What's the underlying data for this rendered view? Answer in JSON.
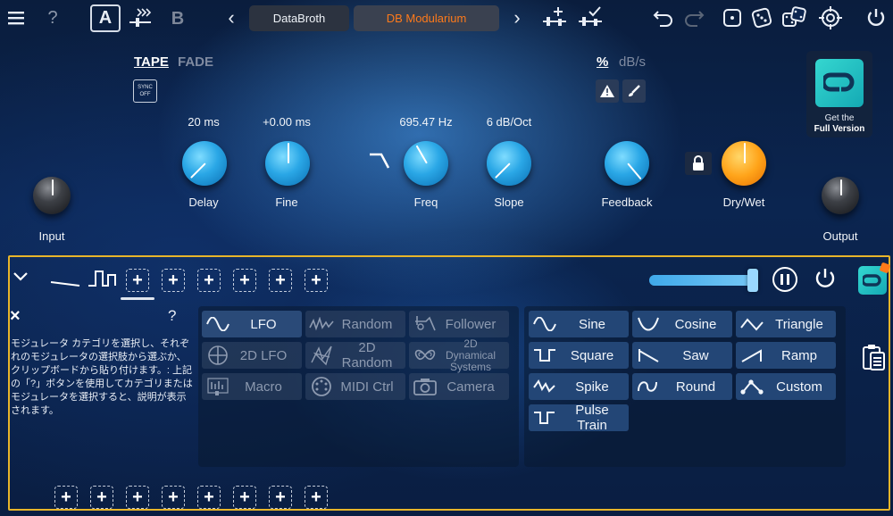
{
  "topbar": {
    "help_label": "?",
    "a_label": "A",
    "b_label": "B",
    "prev_glyph": "‹",
    "next_glyph": "›",
    "preset_left": "DataBroth",
    "preset_right": "DB Modularium"
  },
  "mode": {
    "tape": "TAPE",
    "fade": "FADE",
    "sync_top": "SYNC",
    "sync_bottom": "OFF"
  },
  "units": {
    "percent": "%",
    "db": "dB/s"
  },
  "promo": {
    "line1": "Get the",
    "line2": "Full Version"
  },
  "knobs": {
    "delay": {
      "label": "Delay",
      "value": "20 ms"
    },
    "fine": {
      "label": "Fine",
      "value": "+0.00 ms"
    },
    "freq": {
      "label": "Freq",
      "value": "695.47 Hz"
    },
    "slope": {
      "label": "Slope",
      "value": "6 dB/Oct"
    },
    "feedback": {
      "label": "Feedback"
    },
    "drywet": {
      "label": "Dry/Wet"
    },
    "input": {
      "label": "Input"
    },
    "output": {
      "label": "Output"
    }
  },
  "mod": {
    "close_glyph": "×",
    "help_glyph": "?",
    "add_glyph": "+",
    "description": "モジュレータ カテゴリを選択し、それぞれのモジュレータの選択肢から選ぶか、クリップボードから貼り付けます。: 上記の「?」ボタンを使用してカテゴリまたはモジュレータを選択すると、説明が表示されます。",
    "categories": [
      {
        "label": "LFO",
        "icon": "sine-icon",
        "active": true
      },
      {
        "label": "Random",
        "icon": "random-icon",
        "active": false
      },
      {
        "label": "Follower",
        "icon": "follower-icon",
        "active": false
      },
      {
        "label": "2D LFO",
        "icon": "crosshair-icon",
        "active": false
      },
      {
        "label": "2D Random",
        "icon": "2d-random-icon",
        "active": false
      },
      {
        "label": "2D Dynamical Systems",
        "icon": "attractor-icon",
        "active": false
      },
      {
        "label": "Macro",
        "icon": "macro-icon",
        "active": false
      },
      {
        "label": "MIDI Ctrl",
        "icon": "midi-icon",
        "active": false
      },
      {
        "label": "Camera",
        "icon": "camera-icon",
        "active": false
      }
    ],
    "shapes": [
      {
        "label": "Sine",
        "icon": "sine-icon"
      },
      {
        "label": "Cosine",
        "icon": "cosine-icon"
      },
      {
        "label": "Triangle",
        "icon": "triangle-icon"
      },
      {
        "label": "Square",
        "icon": "square-wave-icon"
      },
      {
        "label": "Saw",
        "icon": "saw-icon"
      },
      {
        "label": "Ramp",
        "icon": "ramp-icon"
      },
      {
        "label": "Spike",
        "icon": "spike-icon"
      },
      {
        "label": "Round",
        "icon": "round-icon"
      },
      {
        "label": "Custom",
        "icon": "custom-icon"
      },
      {
        "label": "Pulse Train",
        "icon": "pulse-train-icon"
      }
    ],
    "slider_level": 0.95
  },
  "colors": {
    "accent_orange": "#ff7a1a",
    "panel_border": "#e8b52a",
    "knob_blue": "#2aa7e6",
    "inactive_text": "#8d9ab0"
  }
}
